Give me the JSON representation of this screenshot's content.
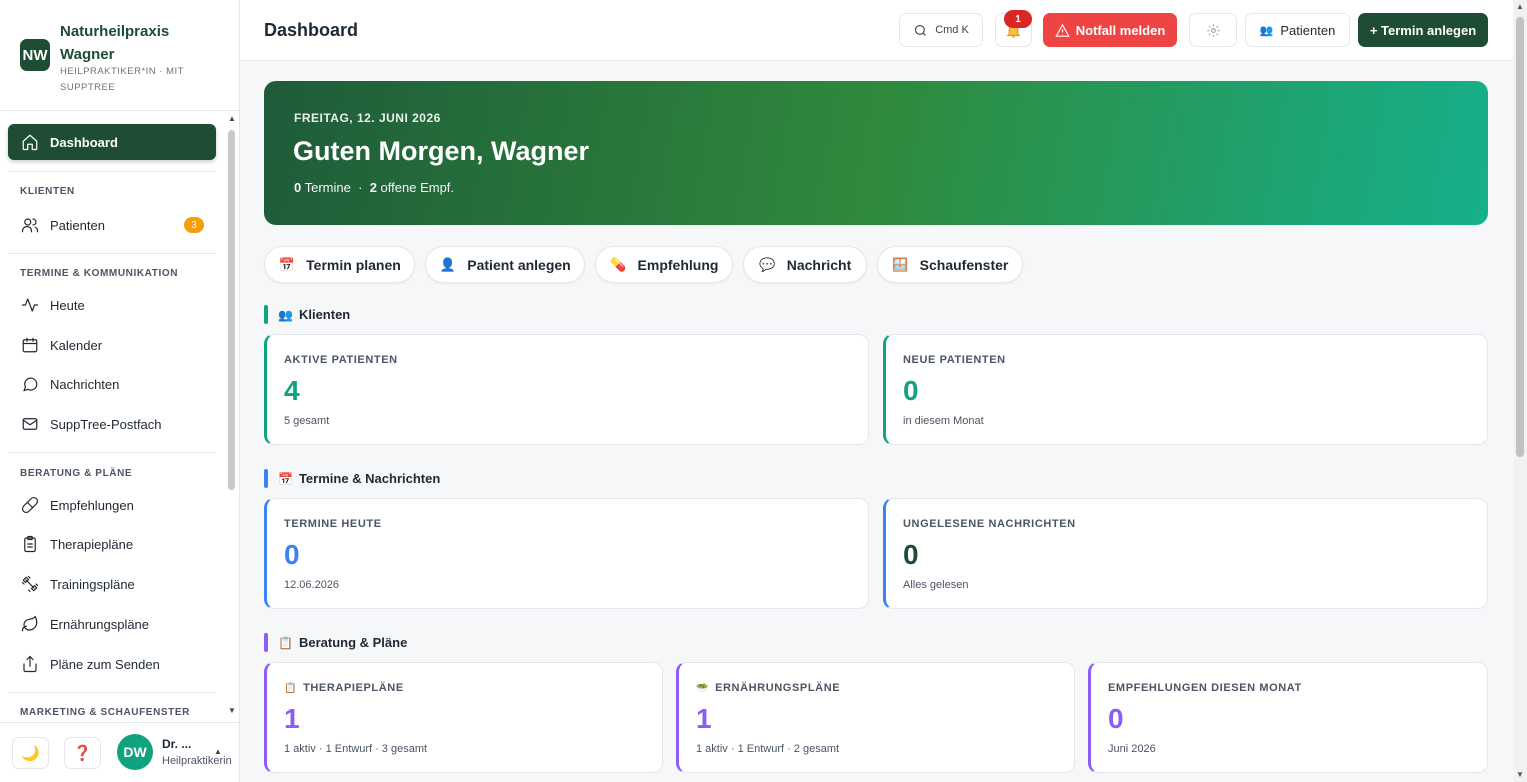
{
  "brand": {
    "logo_initials": "NW",
    "name": "Naturheilpraxis Wagner",
    "subtitle": "HEILPRAKTIKER*IN · MIT SUPPTREE"
  },
  "sidebar": {
    "dashboard": "Dashboard",
    "sections": [
      {
        "title": "KLIENTEN",
        "items": [
          {
            "label": "Patienten",
            "icon": "users-icon",
            "badge": "3"
          }
        ]
      },
      {
        "title": "TERMINE & KOMMUNIKATION",
        "items": [
          {
            "label": "Heute",
            "icon": "activity-icon"
          },
          {
            "label": "Kalender",
            "icon": "calendar-icon"
          },
          {
            "label": "Nachrichten",
            "icon": "message-icon"
          },
          {
            "label": "SuppTree-Postfach",
            "icon": "mail-icon"
          }
        ]
      },
      {
        "title": "BERATUNG & PLÄNE",
        "items": [
          {
            "label": "Empfehlungen",
            "icon": "pill-icon"
          },
          {
            "label": "Therapiepläne",
            "icon": "clipboard-icon"
          },
          {
            "label": "Trainingspläne",
            "icon": "dumbbell-icon"
          },
          {
            "label": "Ernährungspläne",
            "icon": "leaf-icon"
          },
          {
            "label": "Pläne zum Senden",
            "icon": "share-icon"
          }
        ]
      },
      {
        "title": "MARKETING & SCHAUFENSTER",
        "items": []
      }
    ],
    "footer": {
      "theme_icon": "🌙",
      "help_icon": "❓",
      "avatar": "DW",
      "user_name": "Dr. ...",
      "user_role": "Heilpraktikerin"
    }
  },
  "topbar": {
    "title": "Dashboard",
    "search_label": "Cmd K",
    "notif_count": "1",
    "emergency_label": "Notfall melden",
    "patients_label": "Patienten",
    "new_appointment_label": "+ Termin anlegen"
  },
  "hero": {
    "date": "FREITAG, 12. JUNI 2026",
    "greeting": "Guten Morgen, Wagner",
    "appointments_count": "0",
    "appointments_label": "Termine",
    "open_count": "2",
    "open_label": "offene Empf."
  },
  "quick_actions": [
    {
      "label": "Termin planen",
      "emoji": "📅"
    },
    {
      "label": "Patient anlegen",
      "emoji": "👤"
    },
    {
      "label": "Empfehlung",
      "emoji": "💊"
    },
    {
      "label": "Nachricht",
      "emoji": "💬"
    },
    {
      "label": "Schaufenster",
      "emoji": "🪟"
    }
  ],
  "sections": {
    "clients": {
      "title": "Klienten",
      "emoji": "👥",
      "color": "#10a37f",
      "cards": [
        {
          "label": "AKTIVE PATIENTEN",
          "value": "4",
          "note": "5 gesamt",
          "color": "#10a37f"
        },
        {
          "label": "NEUE PATIENTEN",
          "value": "0",
          "note": "in diesem Monat",
          "color": "#10a37f"
        }
      ]
    },
    "appointments": {
      "title": "Termine & Nachrichten",
      "emoji": "📅",
      "color": "#3b82f6",
      "cards": [
        {
          "label": "TERMINE HEUTE",
          "value": "0",
          "note": "12.06.2026",
          "color": "#3b82f6"
        },
        {
          "label": "UNGELESENE NACHRICHTEN",
          "value": "0",
          "note": "Alles gelesen",
          "color": "#1e4d34"
        }
      ]
    },
    "plans": {
      "title": "Beratung & Pläne",
      "emoji": "📋",
      "color": "#8b5cf6",
      "cards": [
        {
          "label": "THERAPIEPLÄNE",
          "emoji": "📋",
          "value": "1",
          "note": "1 aktiv · 1 Entwurf · 3 gesamt",
          "color": "#8b5cf6"
        },
        {
          "label": "ERNÄHRUNGSPLÄNE",
          "emoji": "🥗",
          "value": "1",
          "note": "1 aktiv · 1 Entwurf · 2 gesamt",
          "color": "#8b5cf6"
        },
        {
          "label": "EMPFEHLUNGEN DIESEN MONAT",
          "value": "0",
          "note": "Juni 2026",
          "color": "#8b5cf6"
        }
      ]
    }
  }
}
